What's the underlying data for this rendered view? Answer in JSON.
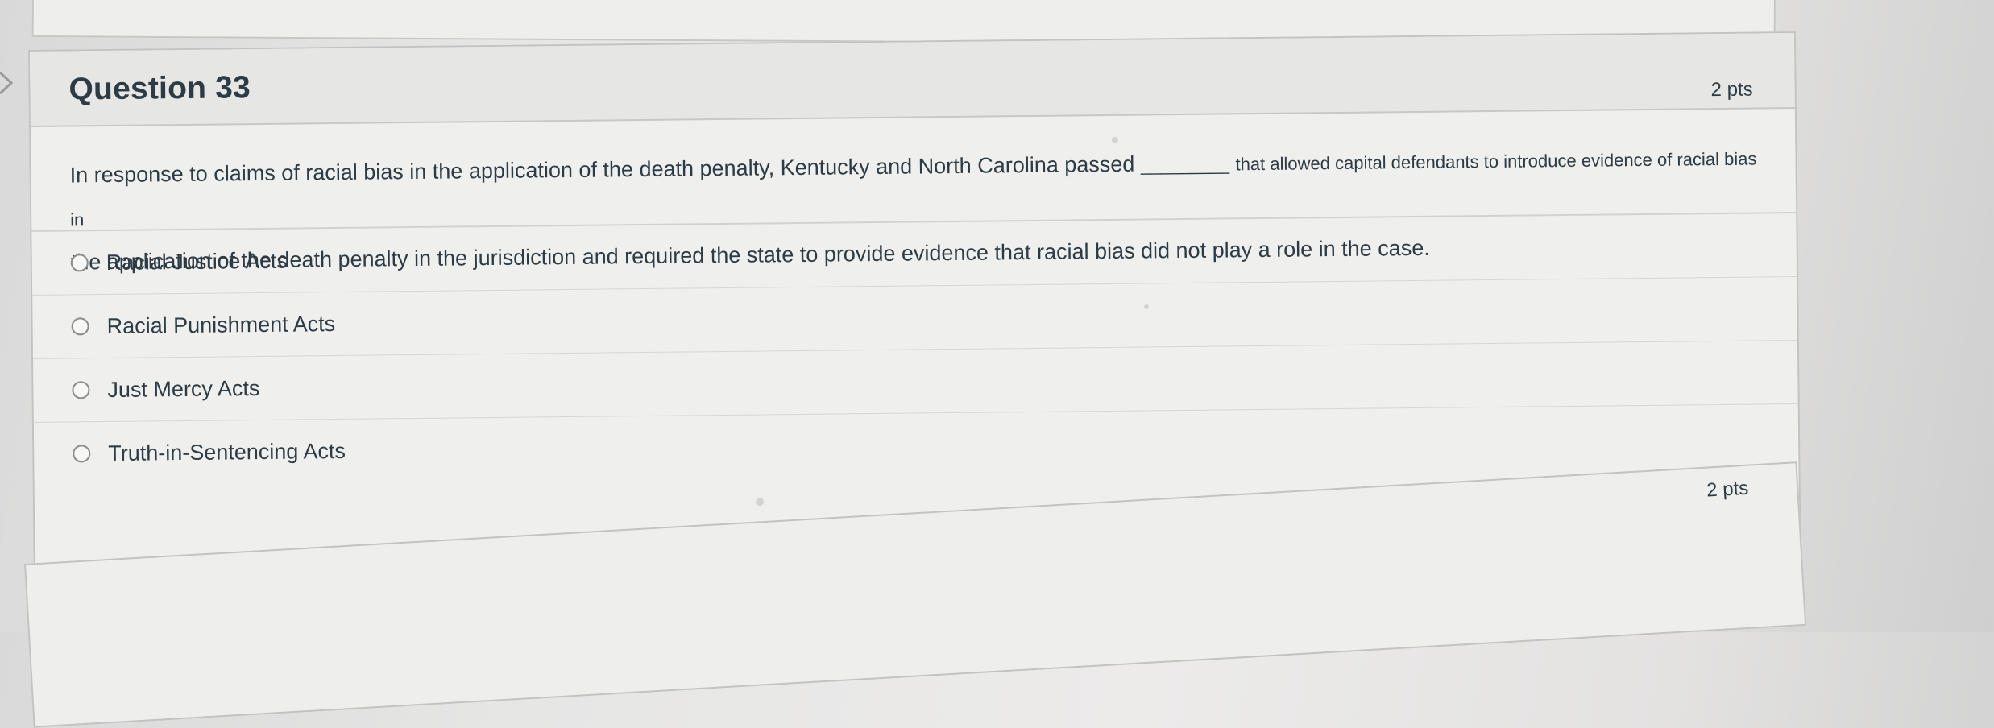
{
  "question": {
    "title": "Question 33",
    "points": "2 pts",
    "text_main": "In response to claims of racial bias in the application of the death penalty, Kentucky and North Carolina passed",
    "blank": "_________",
    "text_small": "that allowed capital defendants to introduce evidence of racial bias in",
    "text_line2": "the application of the death penalty in the jurisdiction and required the state to provide evidence that racial bias did not play a role in the case.",
    "options": [
      {
        "label": "Racial Justice Acts",
        "selected": false
      },
      {
        "label": "Racial Punishment Acts",
        "selected": false
      },
      {
        "label": "Just Mercy Acts",
        "selected": false
      },
      {
        "label": "Truth-in-Sentencing Acts",
        "selected": false
      }
    ]
  },
  "next_question": {
    "points": "2 pts"
  },
  "icons": {
    "collapse": "chevron-right-icon",
    "radio": "radio-unchecked-icon"
  }
}
